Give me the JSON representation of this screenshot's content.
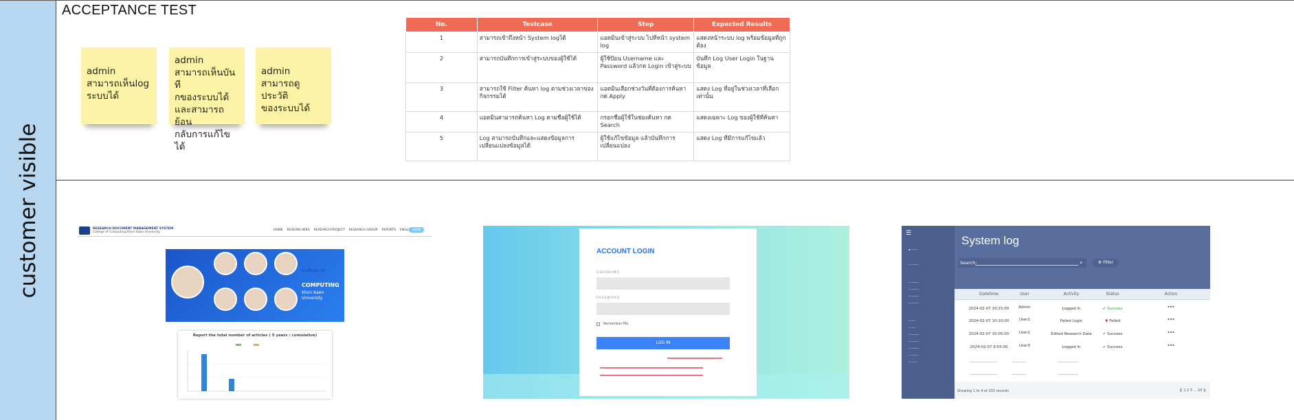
{
  "lane": {
    "label": "customer visible"
  },
  "section": {
    "title": "ACCEPTANCE TEST"
  },
  "stickies": [
    {
      "lines": [
        "admin",
        "สามารถเห็นlog",
        "ระบบได้"
      ]
    },
    {
      "lines": [
        "admin",
        "สามารถเห็นบันที",
        "กของระบบได้",
        "และสามารถย้อน",
        "กลับการแก้ไขได้"
      ]
    },
    {
      "lines": [
        "admin",
        "สามารถดูประวัติ",
        "ของระบบได้"
      ]
    }
  ],
  "testcases": {
    "headers": [
      "No.",
      "Testcase",
      "Step",
      "Expected Results"
    ],
    "rows": [
      {
        "no": "1",
        "testcase": "สามารถเข้าถึงหน้า System logได้",
        "step": "แอดมินเข้าสู่ระบบ ไปที่หน้า system log",
        "expected": "แสดงหน้าระบบ log พร้อมข้อมูลที่ถูกต้อง"
      },
      {
        "no": "2",
        "testcase": "สามารถบันทึกการเข้าสู่ระบบของผู้ใช้ได้",
        "step": "ผู้ใช้ป้อน Username และ Password แล้วกด Login เข้าสู่ระบบ",
        "expected": "บันทึก Log User Login ในฐานข้อมูล"
      },
      {
        "no": "3",
        "testcase": "สามารถใช้ Filter ค้นหา log ตามช่วงเวลาของกิจกรรมได้",
        "step": "แอดมินเลือกช่วงวันที่ต้องการค้นหา กด Apply",
        "expected": "แสดง Log ที่อยู่ในช่วงเวลาที่เลือกเท่านั้น"
      },
      {
        "no": "4",
        "testcase": "แอดมินสามารถค้นหา Log ตามชื่อผู้ใช้ได้",
        "step": "กรอกชื่อผู้ใช้ในช่องค้นหา กด Search",
        "expected": "แสดงเฉพาะ Log ของผู้ใช้ที่ค้นหา"
      },
      {
        "no": "5",
        "testcase": "Log สามารถบันทึกและแสดงข้อมูลการเปลี่ยนแปลงข้อมูลได้",
        "step": "ผู้ใช้แก้ไขข้อมูล แล้วบันทึกการเปลี่ยนแปลง",
        "expected": "แสดง Log ที่มีการแก้ไขแล้ว"
      }
    ]
  },
  "shot_research": {
    "brand": "RESEARCH DOCUMENT MANAGEMENT SYSTEM",
    "brand_sub": "College of Computing Khon Kaen University",
    "menu": [
      "HOME",
      "RESEARCHERS",
      "RESEARCH PROJECT",
      "RESEARCH GROUP",
      "REPORTS",
      "ENGLISH"
    ],
    "login": "LOGIN",
    "banner_college": "College of",
    "banner_computing": "COMPUTING",
    "banner_kku": "Khon Kaen University",
    "chart_title": "Report the total number of articles ( 5 years : cumulative)"
  },
  "shot_login": {
    "title": "ACCOUNT LOGIN",
    "username_label": "USERNAME",
    "password_label": "PASSWORD",
    "remember": "Remember Me",
    "button": "LOG IN"
  },
  "shot_log": {
    "title": "System log",
    "search_label": "Search:",
    "filter": "Filter",
    "columns": [
      "Datetime",
      "User",
      "Activity",
      "Status",
      "Action"
    ],
    "rows": [
      {
        "datetime": "2024-02-07 10:15:00",
        "user": "Admin",
        "activity": "Logged In",
        "status": "Success",
        "ok": true
      },
      {
        "datetime": "2024-02-07 10:10:00",
        "user": "User1",
        "activity": "Failed Login",
        "status": "Failed",
        "ok": false
      },
      {
        "datetime": "2024-02-07 10:05:00",
        "user": "User2",
        "activity": "Edited Research Data",
        "status": "Success",
        "ok": true
      },
      {
        "datetime": "2024-02-07 9:55:00",
        "user": "User3",
        "activity": "Logged In",
        "status": "Success",
        "ok": true
      }
    ],
    "footer_left": "Showing 1 to 4 of 200 records",
    "pagination": "1  2  3  ...  10"
  }
}
